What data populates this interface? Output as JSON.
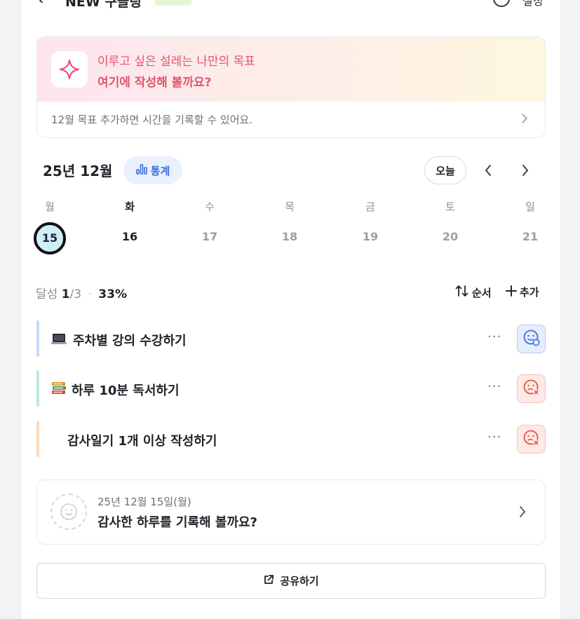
{
  "header": {
    "back_glyph": "‹",
    "title": "NEW 구글링",
    "right_label": "설정"
  },
  "goal_banner": {
    "line1": "이루고 싶은 설레는 나만의 목표",
    "line2": "여기에 작성해 볼까요?",
    "hint": "12월 목표  추가하면 시간을 기록할 수 있어요.",
    "icon": "sparkle-icon"
  },
  "calendar": {
    "month_label": "25년 12월",
    "stats_label": "통계",
    "today_label": "오늘",
    "weekdays": [
      "월",
      "화",
      "수",
      "목",
      "금",
      "토",
      "일"
    ],
    "dates": [
      "15",
      "16",
      "17",
      "18",
      "19",
      "20",
      "21"
    ],
    "selected_index": 0
  },
  "progress": {
    "label": "달성",
    "done": "1",
    "total": "/3",
    "separator": "·",
    "percent": "33%",
    "sort_label": "순서",
    "add_label": "추가"
  },
  "tasks": [
    {
      "label": "주차별 강의 수강하기",
      "emoji": "laptop-icon",
      "bar_color": "#c9d9f7",
      "status": "done"
    },
    {
      "label": "하루 10분 독서하기",
      "emoji": "books-icon",
      "bar_color": "#bfe8d2",
      "status": "missed"
    },
    {
      "label": "감사일기 1개 이상 작성하기",
      "emoji": "",
      "bar_color": "#fbdcbc",
      "status": "missed"
    }
  ],
  "task_more": "···",
  "diary": {
    "date": "25년 12월 15일(월)",
    "prompt": "감사한 하루를 기록해 볼까요?"
  },
  "share": {
    "label": "공유하기"
  },
  "colors": {
    "accent_blue": "#3b6fe0",
    "accent_red": "#e0566c"
  }
}
